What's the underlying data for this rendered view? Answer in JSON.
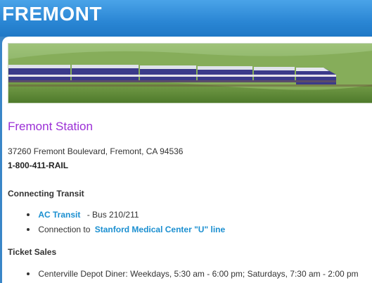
{
  "header": {
    "title": "FREMONT"
  },
  "station": {
    "title": "Fremont Station",
    "address": "37260 Fremont Boulevard, Fremont, CA 94536",
    "phone": "1-800-411-RAIL"
  },
  "connecting_transit": {
    "heading": "Connecting Transit",
    "items": [
      {
        "link": "AC Transit",
        "text": "- Bus 210/211"
      },
      {
        "prefix": "Connection to",
        "link": "Stanford Medical Center \"U\" line"
      }
    ]
  },
  "ticket_sales": {
    "heading": "Ticket Sales",
    "items": [
      {
        "text": "Centerville Depot Diner: Weekdays, 5:30 am - 6:00 pm; Saturdays, 7:30 am - 2:00 pm"
      }
    ]
  },
  "colors": {
    "header_blue": "#2a86d4",
    "title_purple": "#9b2fd6",
    "link_blue": "#1b8fd0"
  }
}
